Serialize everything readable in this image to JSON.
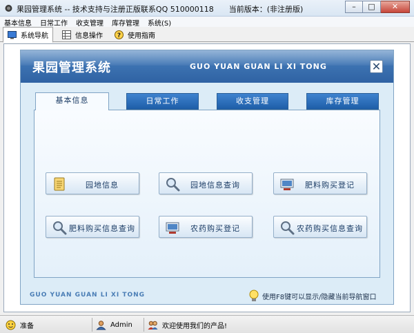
{
  "window": {
    "title": "果园管理系统 -- 技术支持与注册正版联系QQ 510000118　　当前版本：(非注册版)",
    "min_glyph": "–",
    "max_glyph": "□",
    "close_glyph": "✕"
  },
  "menu": [
    "基本信息",
    "日常工作",
    "收支管理",
    "库存管理",
    "系统(S)"
  ],
  "app_tabs": [
    {
      "label": "系统导航",
      "icon": "monitor-icon",
      "active": true
    },
    {
      "label": "信息操作",
      "icon": "grid-icon",
      "active": false
    },
    {
      "label": "使用指南",
      "icon": "help-icon",
      "active": false
    }
  ],
  "panel": {
    "title": "果园管理系统",
    "subtitle": "GUO YUAN GUAN LI XI TONG",
    "close_glyph": "✕",
    "footer_text": "GUO YUAN GUAN LI XI TONG",
    "footer_tip": "使用F8键可以显示/隐藏当前导航窗口"
  },
  "inner_tabs": [
    "基本信息",
    "日常工作",
    "收支管理",
    "库存管理"
  ],
  "buttons": [
    {
      "label": "园地信息",
      "icon": "notepad-icon"
    },
    {
      "label": "园地信息查询",
      "icon": "magnifier-icon"
    },
    {
      "label": "肥料购买登记",
      "icon": "register-icon"
    },
    {
      "label": "肥料购买信息查询",
      "icon": "magnifier-icon"
    },
    {
      "label": "农药购买登记",
      "icon": "register-icon"
    },
    {
      "label": "农药购买信息查询",
      "icon": "magnifier-icon"
    }
  ],
  "status": {
    "ready": "准备",
    "user": "Admin",
    "welcome": "欢迎使用我们的产品!"
  },
  "colors": {
    "accent": "#2f62a3",
    "tab_blue": "#1e5ea8"
  }
}
